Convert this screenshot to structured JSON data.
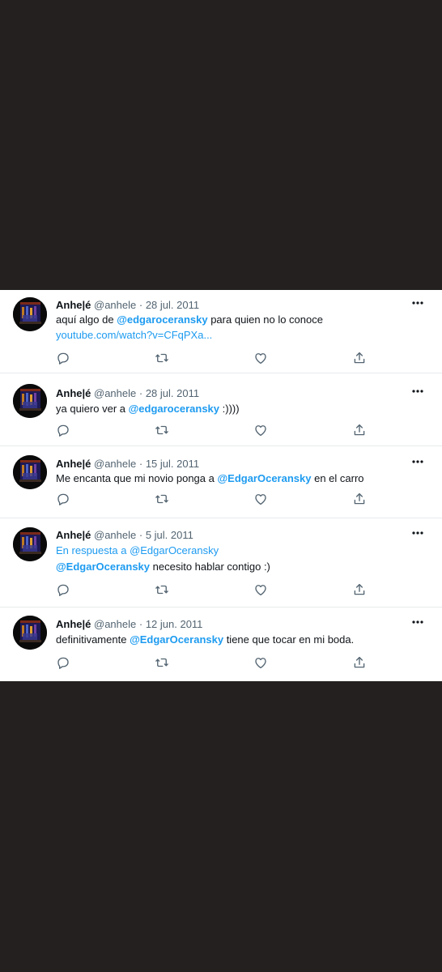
{
  "tweets": [
    {
      "name": "Anhe|é",
      "handle": "@anhele",
      "date": "· 28 jul. 2011",
      "line1_pre": "aquí algo de ",
      "line1_mention": "@edgaroceransky",
      "line1_post": " para quien no lo conoce",
      "link": "youtube.com/watch?v=CFqPXa..."
    },
    {
      "name": "Anhe|é",
      "handle": "@anhele",
      "date": "· 28 jul. 2011",
      "pre": "ya quiero ver a ",
      "mention": "@edgaroceransky",
      "post": " :))))"
    },
    {
      "name": "Anhe|é",
      "handle": "@anhele",
      "date": "· 15 jul. 2011",
      "pre": "Me encanta que mi novio ponga a ",
      "mention": "@EdgarOceransky",
      "post": " en el carro"
    },
    {
      "name": "Anhe|é",
      "handle": "@anhele",
      "date": "· 5 jul. 2011",
      "reply_label": "En respuesta a ",
      "reply_to": "@EdgarOceransky",
      "mention": "@EdgarOceransky",
      "post": " necesito hablar contigo :)"
    },
    {
      "name": "Anhe|é",
      "handle": "@anhele",
      "date": "· 12 jun. 2011",
      "pre": "definitivamente ",
      "mention": "@EdgarOceransky",
      "post": " tiene que tocar en mi boda."
    }
  ],
  "icons": {
    "more": "more-icon",
    "reply": "reply-icon",
    "retweet": "retweet-icon",
    "like": "heart-icon",
    "share": "share-icon"
  },
  "colors": {
    "background": "#252020",
    "link": "#1d9bf0",
    "icon": "#536471"
  }
}
